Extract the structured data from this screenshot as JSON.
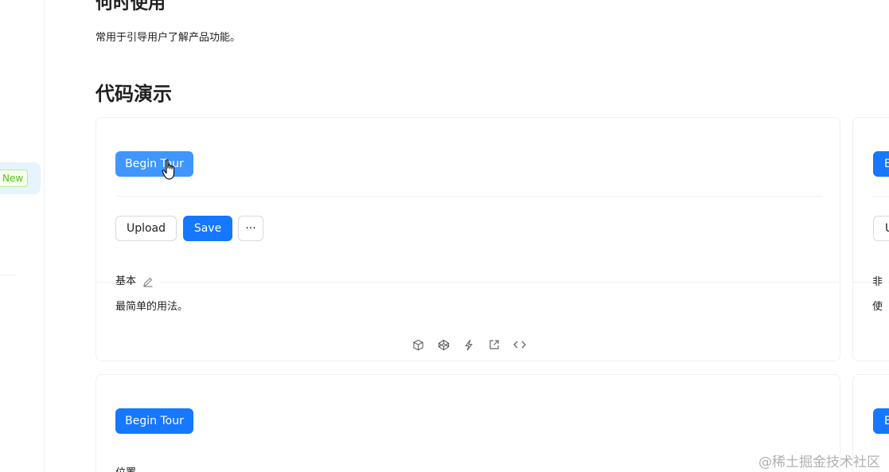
{
  "sidebar": {
    "new_badge": "New"
  },
  "section_usage": {
    "title": "何时使用",
    "description": "常用于引导用户了解产品功能。"
  },
  "section_demo": {
    "title": "代码演示"
  },
  "demo_basic": {
    "begin_tour_label": "Begin Tour",
    "upload_label": "Upload",
    "save_label": "Save",
    "more_label": "···",
    "meta_title": "基本",
    "meta_description": "最简单的用法。"
  },
  "demo_right_partial": {
    "button_text": "B",
    "upload_text": "U",
    "meta_title": "非",
    "meta_description": "使"
  },
  "demo_second": {
    "begin_tour_label": "Begin Tour",
    "meta_title": "位置"
  },
  "demo_fourth_partial": {
    "button_text": "B"
  },
  "watermark": "@稀土掘金技术社区",
  "colors": {
    "primary": "#1677ff",
    "primary_hover": "#4096ff",
    "border": "#f0f0f0",
    "badge_green": "#52c41a"
  }
}
